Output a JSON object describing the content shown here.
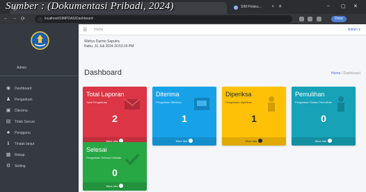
{
  "browser": {
    "watermark": "Sumber : (Dokumentasi Pribadi, 2024)",
    "active_tab_title": "localhost/SIMPDAS/Dashboard",
    "second_tab_title": "SIM Pelaku...",
    "url": "localhost/SIMPDAS/dashboard",
    "profile_label": "Done"
  },
  "sidebar": {
    "brand": "Admin",
    "items": [
      {
        "icon": "dashboard-icon",
        "label": "Dashboard"
      },
      {
        "icon": "user-icon",
        "label": "Pengaduan"
      },
      {
        "icon": "inbox-icon",
        "label": "Diterima"
      },
      {
        "icon": "list-icon",
        "label": "Tidak Sesuai"
      },
      {
        "icon": "users-icon",
        "label": "Pengguna"
      },
      {
        "icon": "info-icon",
        "label": "Tindak lanjut"
      },
      {
        "icon": "book-icon",
        "label": "Rekap"
      },
      {
        "icon": "gear-icon",
        "label": "Setting"
      }
    ]
  },
  "topnav": {
    "home": "Home",
    "user": "Admin ▾"
  },
  "welcome": {
    "line1": "Wahyu Darmo Saputra",
    "line2": "Rabu, 31 Juli 2024 20:53:16 PM"
  },
  "page": {
    "title": "Dashboard",
    "crumb_home": "Home",
    "crumb_sep": " / ",
    "crumb_current": "Dashboard"
  },
  "cards": [
    {
      "title": "Total Laporan",
      "subtitle": "Total Pengaduan",
      "count": "2",
      "footer": "More info",
      "color": "#dc3545"
    },
    {
      "title": "Diterima",
      "subtitle": "Pengaduan Diterima",
      "count": "1",
      "footer": "More info",
      "color": "#17a2e8"
    },
    {
      "title": "Diperiksa",
      "subtitle": "Pengaduan diperiksa",
      "count": "1",
      "footer": "More info",
      "color": "#ffc107"
    },
    {
      "title": "Pemulihan",
      "subtitle": "Pengaduan Dalam Pemulihan",
      "count": "0",
      "footer": "More info",
      "color": "#17a2b8"
    },
    {
      "title": "Selesai",
      "subtitle": "Pengaduan Selesai Ditindak",
      "count": "0",
      "footer": "More info",
      "color": "#28a745"
    }
  ]
}
